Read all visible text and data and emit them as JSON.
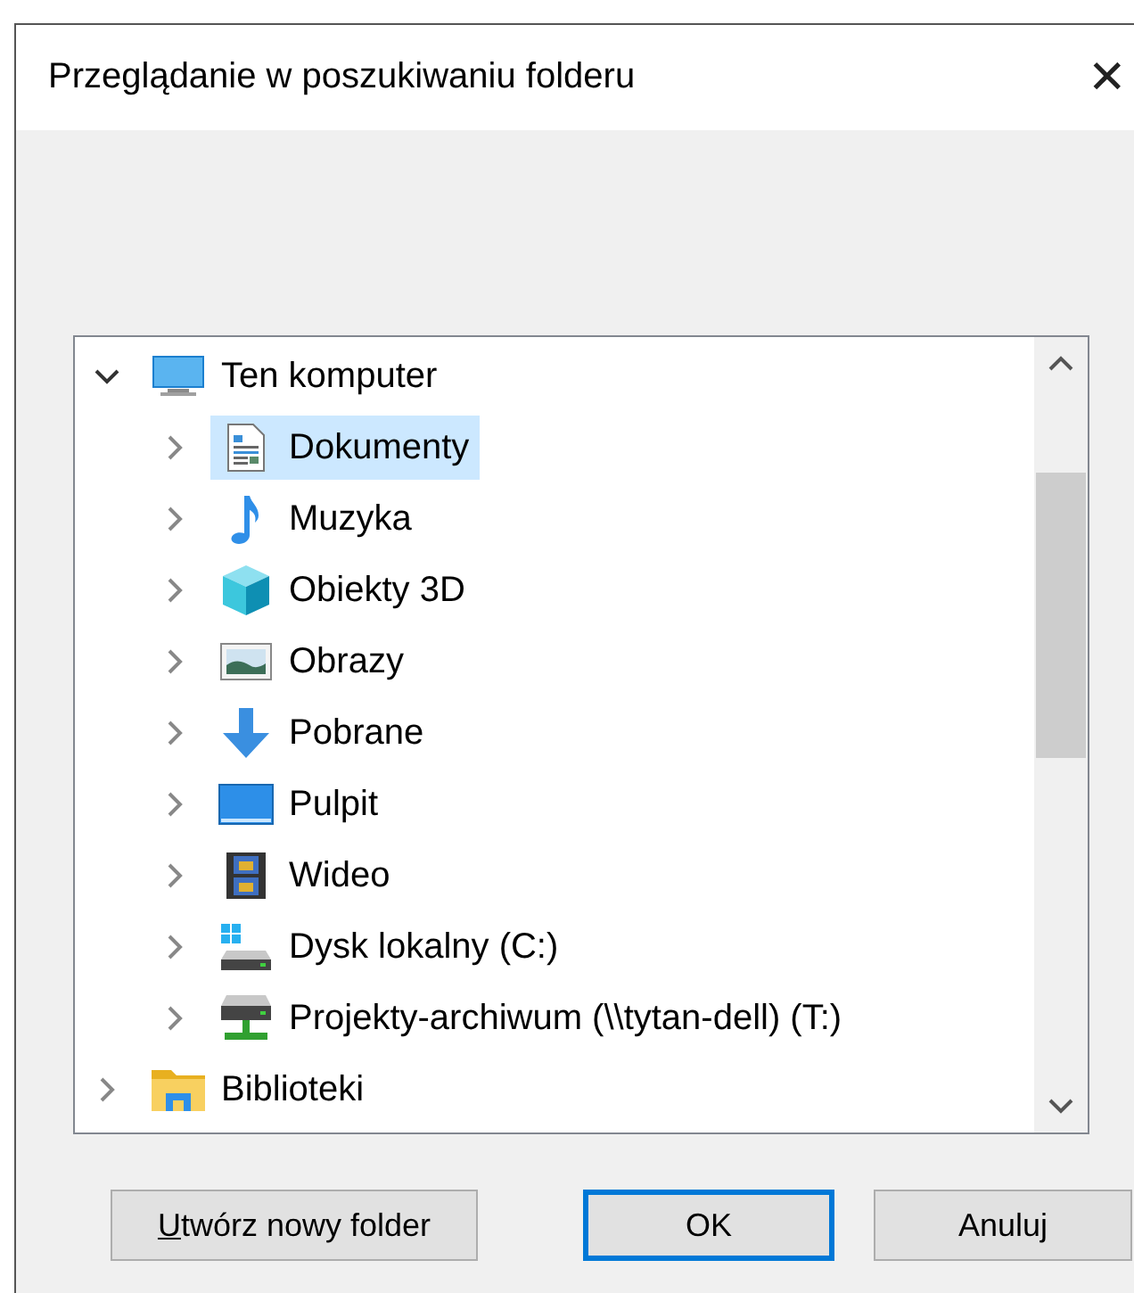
{
  "window": {
    "title": "Przeglądanie w poszukiwaniu folderu",
    "close": "✕"
  },
  "tree": [
    {
      "label": "Ten komputer",
      "kind": "computer",
      "expanded": true,
      "selected": false,
      "children": [
        {
          "label": "Dokumenty",
          "kind": "documents",
          "expanded": false,
          "selected": true
        },
        {
          "label": "Muzyka",
          "kind": "music",
          "expanded": false,
          "selected": false
        },
        {
          "label": "Obiekty 3D",
          "kind": "cube",
          "expanded": false,
          "selected": false
        },
        {
          "label": "Obrazy",
          "kind": "pictures",
          "expanded": false,
          "selected": false
        },
        {
          "label": "Pobrane",
          "kind": "download",
          "expanded": false,
          "selected": false
        },
        {
          "label": "Pulpit",
          "kind": "desktop",
          "expanded": false,
          "selected": false
        },
        {
          "label": "Wideo",
          "kind": "video",
          "expanded": false,
          "selected": false
        },
        {
          "label": "Dysk lokalny (C:)",
          "kind": "drive",
          "expanded": false,
          "selected": false
        },
        {
          "label": "Projekty-archiwum (\\\\tytan-dell) (T:)",
          "kind": "netdrive",
          "expanded": false,
          "selected": false
        }
      ]
    },
    {
      "label": "Biblioteki",
      "kind": "library",
      "expanded": false,
      "selected": false
    }
  ],
  "buttons": [
    {
      "label": "Utwórz nowy folder",
      "default": false,
      "access_key_first": true
    },
    {
      "label": "OK",
      "default": true,
      "access_key_first": false
    },
    {
      "label": "Anuluj",
      "default": false,
      "access_key_first": false
    }
  ]
}
